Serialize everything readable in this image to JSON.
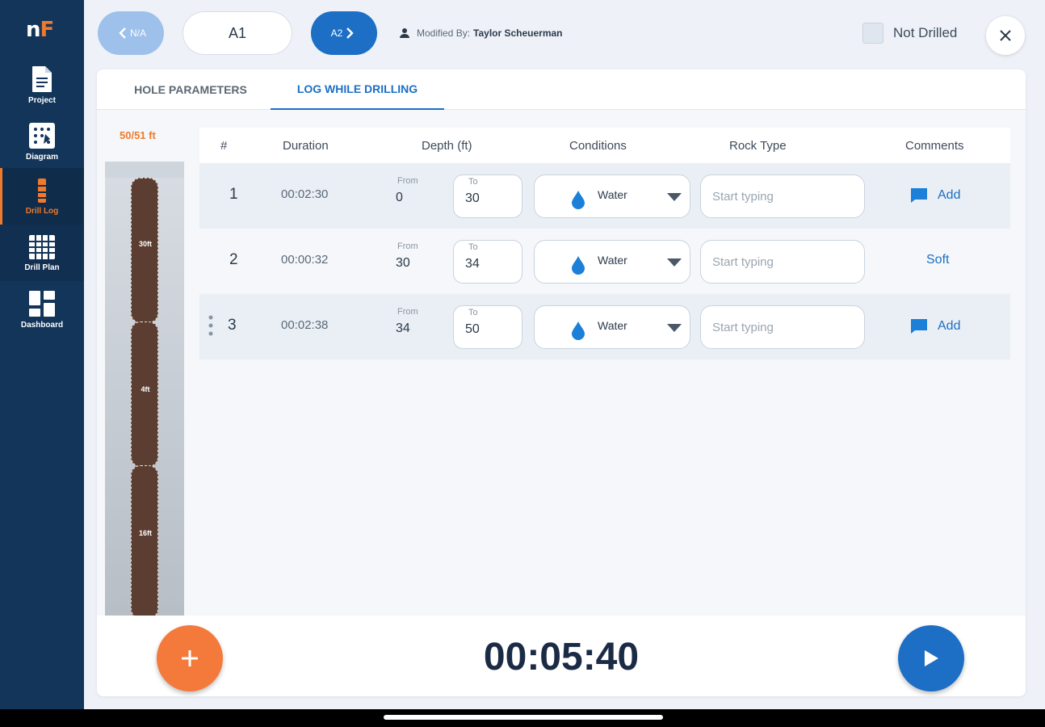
{
  "app": {
    "logo_n": "n",
    "logo_f": "F"
  },
  "sidebar": {
    "items": [
      {
        "label": "Project",
        "icon": "document-icon"
      },
      {
        "label": "Diagram",
        "icon": "diagram-icon"
      },
      {
        "label": "Drill Log",
        "icon": "drill-log-icon"
      },
      {
        "label": "Drill Plan",
        "icon": "grid-icon"
      },
      {
        "label": "Dashboard",
        "icon": "dashboard-icon"
      }
    ]
  },
  "topbar": {
    "prev_label": "N/A",
    "current_hole": "A1",
    "next_label": "A2",
    "modified_prefix": "Modified By:",
    "modified_by": "Taylor Scheuerman",
    "not_drilled_label": "Not Drilled"
  },
  "tabs": [
    {
      "label": "HOLE PARAMETERS",
      "active": false
    },
    {
      "label": "LOG WHILE DRILLING",
      "active": true
    }
  ],
  "depth": {
    "progress": "50/51 ft",
    "segments": [
      {
        "label": "30ft"
      },
      {
        "label": "4ft"
      },
      {
        "label": "16ft"
      }
    ]
  },
  "table": {
    "headers": [
      "#",
      "Duration",
      "Depth (ft)",
      "Conditions",
      "Rock Type",
      "Comments"
    ],
    "from_label": "From",
    "to_label": "To",
    "rock_placeholder": "Start typing",
    "rows": [
      {
        "num": "1",
        "duration": "00:02:30",
        "from": "0",
        "to": "30",
        "condition": "Water",
        "comment": "Add"
      },
      {
        "num": "2",
        "duration": "00:00:32",
        "from": "30",
        "to": "34",
        "condition": "Water",
        "comment": "Soft"
      },
      {
        "num": "3",
        "duration": "00:02:38",
        "from": "34",
        "to": "50",
        "condition": "Water",
        "comment": "Add"
      }
    ]
  },
  "bottom": {
    "timer": "00:05:40"
  },
  "colors": {
    "accent": "#1c6fc5",
    "orange": "#f47a3c",
    "sidebar": "#13355a"
  }
}
